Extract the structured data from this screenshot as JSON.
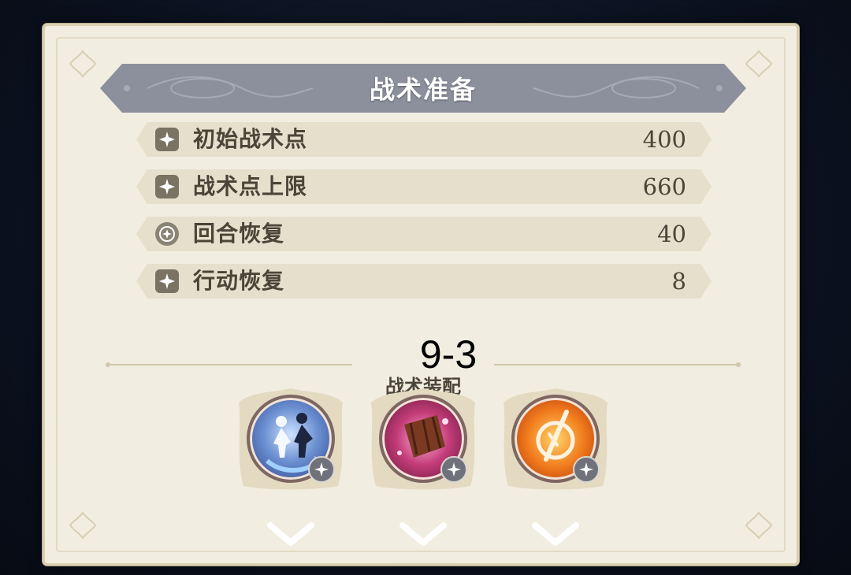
{
  "title": "战术准备",
  "stats": [
    {
      "icon": "tactic-point-icon",
      "label": "初始战术点",
      "value": "400"
    },
    {
      "icon": "tactic-point-icon",
      "label": "战术点上限",
      "value": "660"
    },
    {
      "icon": "round-recovery-icon",
      "label": "回合恢复",
      "value": "40"
    },
    {
      "icon": "tactic-point-icon",
      "label": "行动恢复",
      "value": "8"
    }
  ],
  "level": "9-3",
  "loadout": {
    "label": "战术装配",
    "skills": [
      {
        "icon": "swap-figures-icon",
        "badge": "diamond-star-icon"
      },
      {
        "icon": "wooden-shield-icon",
        "badge": "spark-star-icon"
      },
      {
        "icon": "flame-slash-icon",
        "badge": "burst-star-icon"
      }
    ]
  },
  "colors": {
    "panel": "#f1ede0",
    "banner": "#8c909d",
    "row": "#e6dfcc",
    "text": "#4a4538"
  }
}
